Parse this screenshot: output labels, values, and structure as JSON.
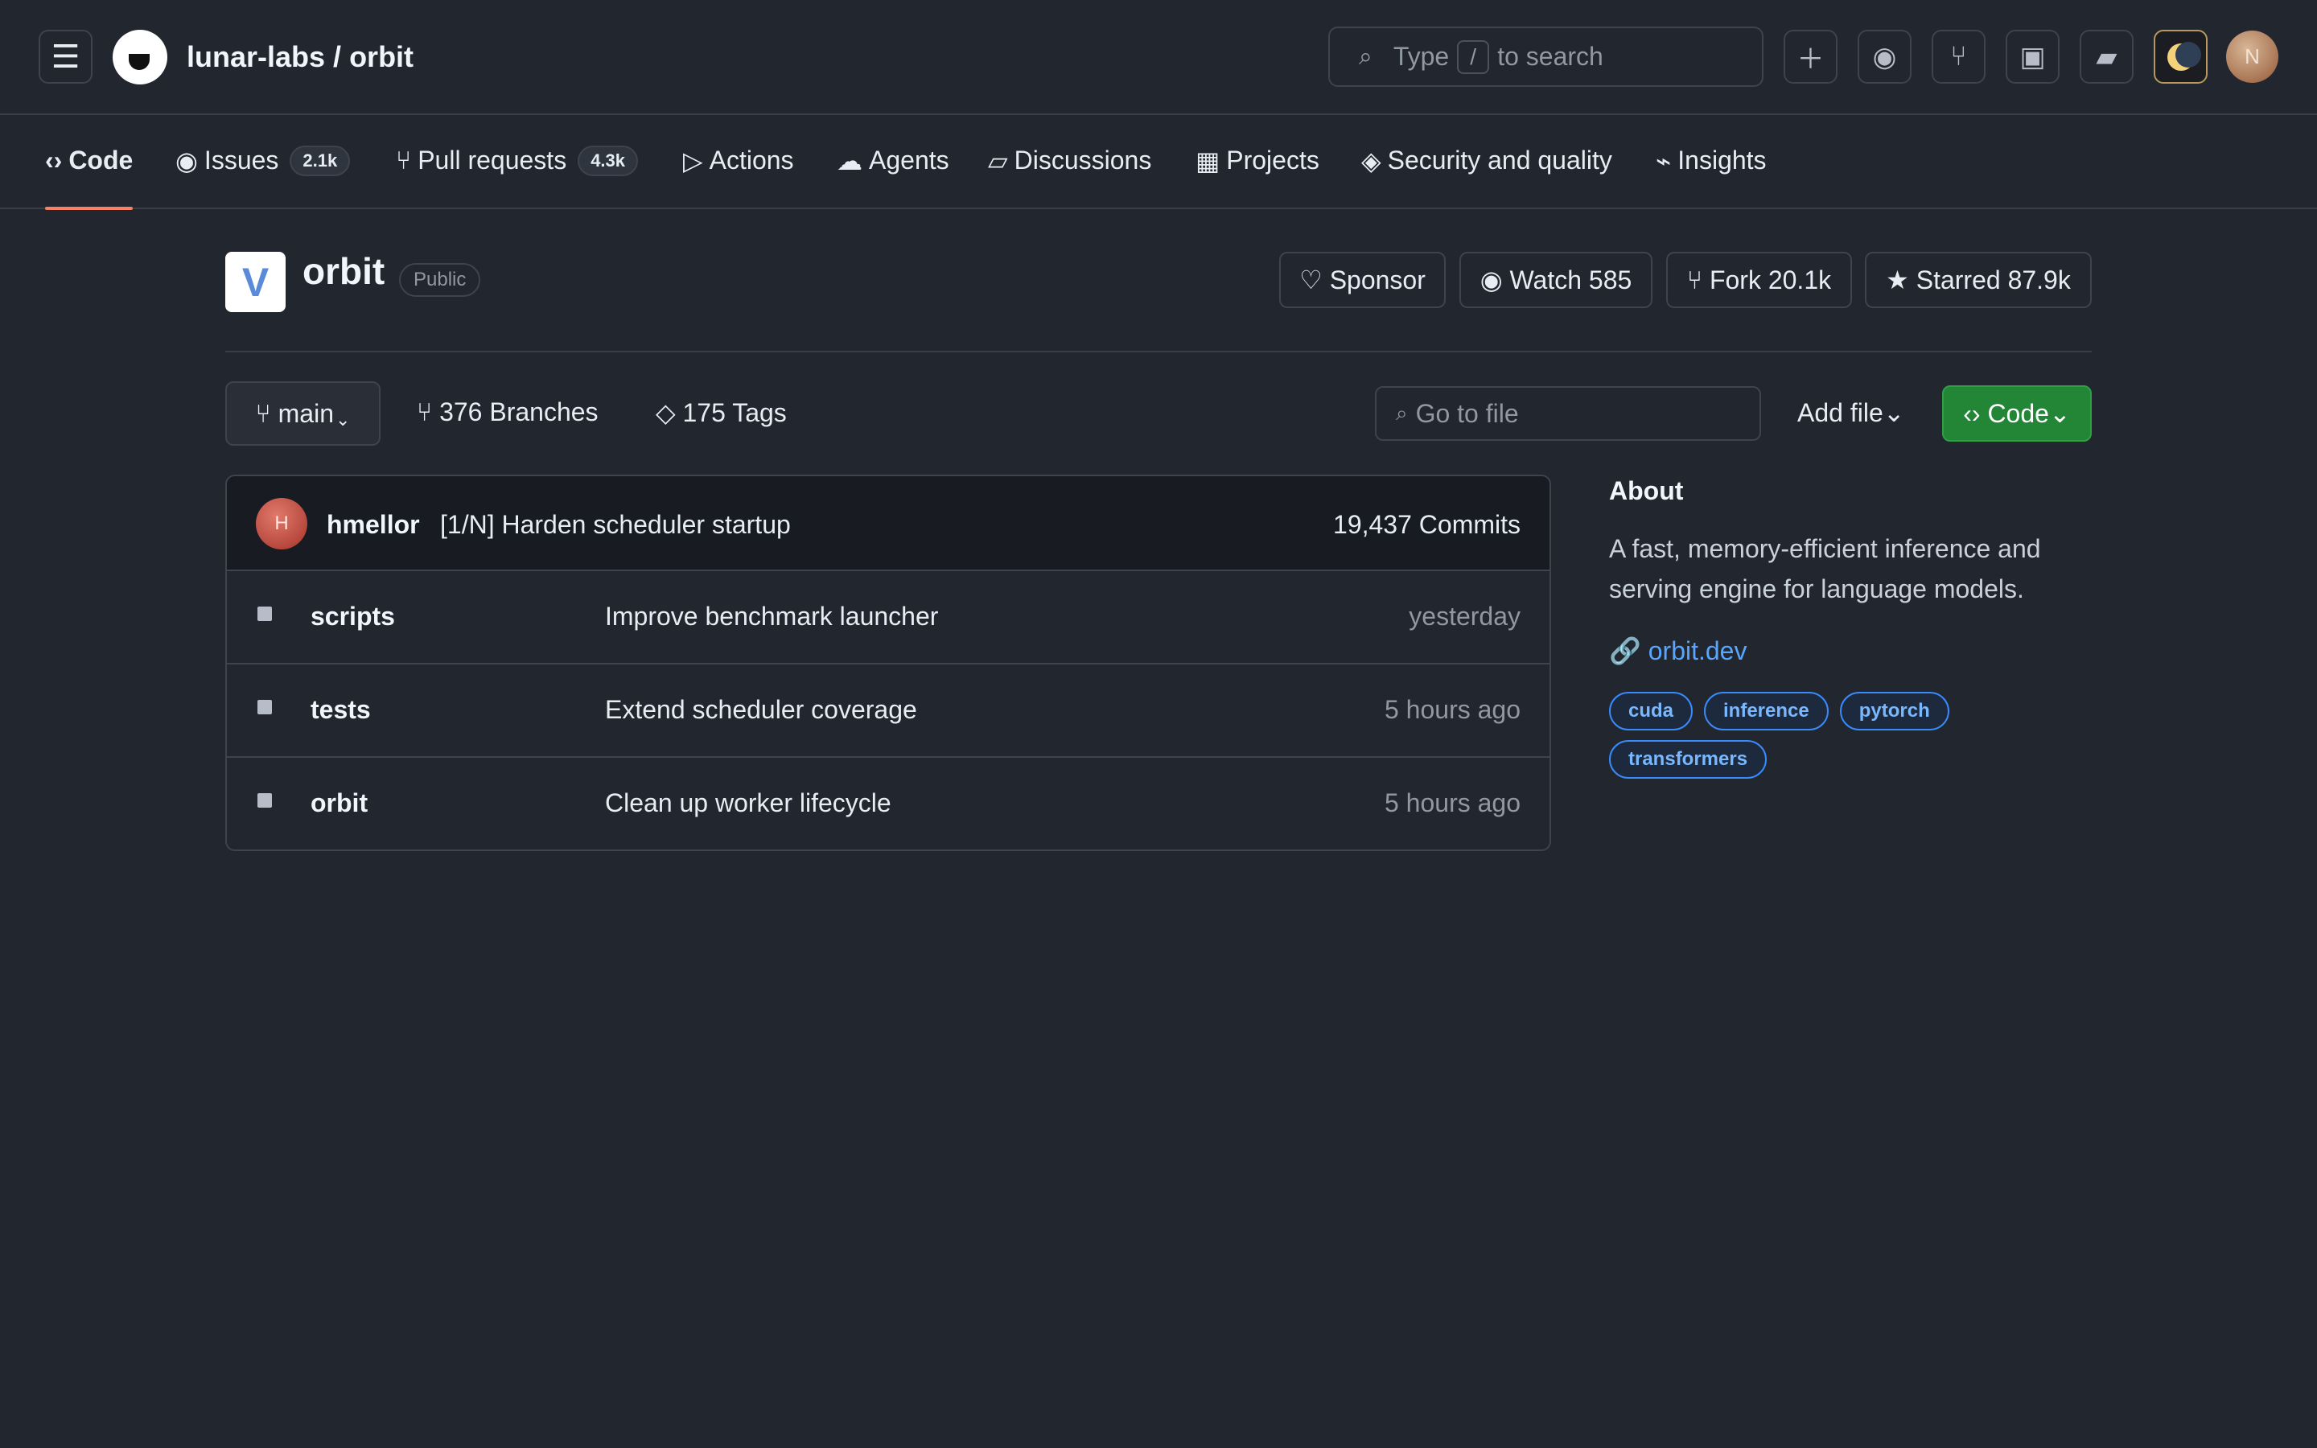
{
  "header": {
    "menu_icon": "menu-icon",
    "owner": "lunar-labs",
    "separator": " / ",
    "repo": "orbit",
    "search_prefix": "Type",
    "search_key": "/",
    "search_suffix": "to search",
    "buttons": [
      "plus-icon",
      "issues-icon",
      "pull-requests-icon",
      "terminal-icon",
      "inbox-icon",
      "theme-toggle-icon"
    ],
    "avatar_initial": "N"
  },
  "tabs": [
    {
      "icon": "‹›",
      "label": "Code",
      "active": true
    },
    {
      "icon": "◉",
      "label": "Issues",
      "count": "2.1k"
    },
    {
      "icon": "⑂",
      "label": "Pull requests",
      "count": "4.3k"
    },
    {
      "icon": "▷",
      "label": "Actions"
    },
    {
      "icon": "☁",
      "label": "Agents"
    },
    {
      "icon": "▱",
      "label": "Discussions"
    },
    {
      "icon": "▦",
      "label": "Projects"
    },
    {
      "icon": "◈",
      "label": "Security and quality"
    },
    {
      "icon": "⌁",
      "label": "Insights"
    }
  ],
  "repo": {
    "icon_letter": "V",
    "name": "orbit",
    "visibility": "Public",
    "sponsor": "♡ Sponsor",
    "watch": "◉ Watch 585",
    "fork": "⑂ Fork 20.1k",
    "star": "★ Starred 87.9k"
  },
  "toolbar": {
    "branch": "⑂ main",
    "branch_caret": "⌄",
    "branches": "⑂ 376 Branches",
    "tags": "◇ 175 Tags",
    "goto_placeholder": "Go to file",
    "add_file": "Add file⌄",
    "code": "‹› Code⌄"
  },
  "latest_commit": {
    "avatar_initial": "H",
    "author": "hmellor",
    "message": "[1/N] Harden scheduler startup",
    "count": "19,437 Commits"
  },
  "files": [
    {
      "name": "scripts",
      "message": "Improve benchmark launcher",
      "time": "yesterday"
    },
    {
      "name": "tests",
      "message": "Extend scheduler coverage",
      "time": "5 hours ago"
    },
    {
      "name": "orbit",
      "message": "Clean up worker lifecycle",
      "time": "5 hours ago"
    }
  ],
  "about": {
    "title": "About",
    "description": "A fast, memory-efficient inference and serving engine for language models.",
    "link": "🔗 orbit.dev",
    "topics": [
      "cuda",
      "inference",
      "pytorch",
      "transformers"
    ]
  },
  "colors": {
    "background": "#22262e",
    "accent_tab": "#f78166",
    "primary_button": "#238636",
    "link": "#58a6ff"
  }
}
